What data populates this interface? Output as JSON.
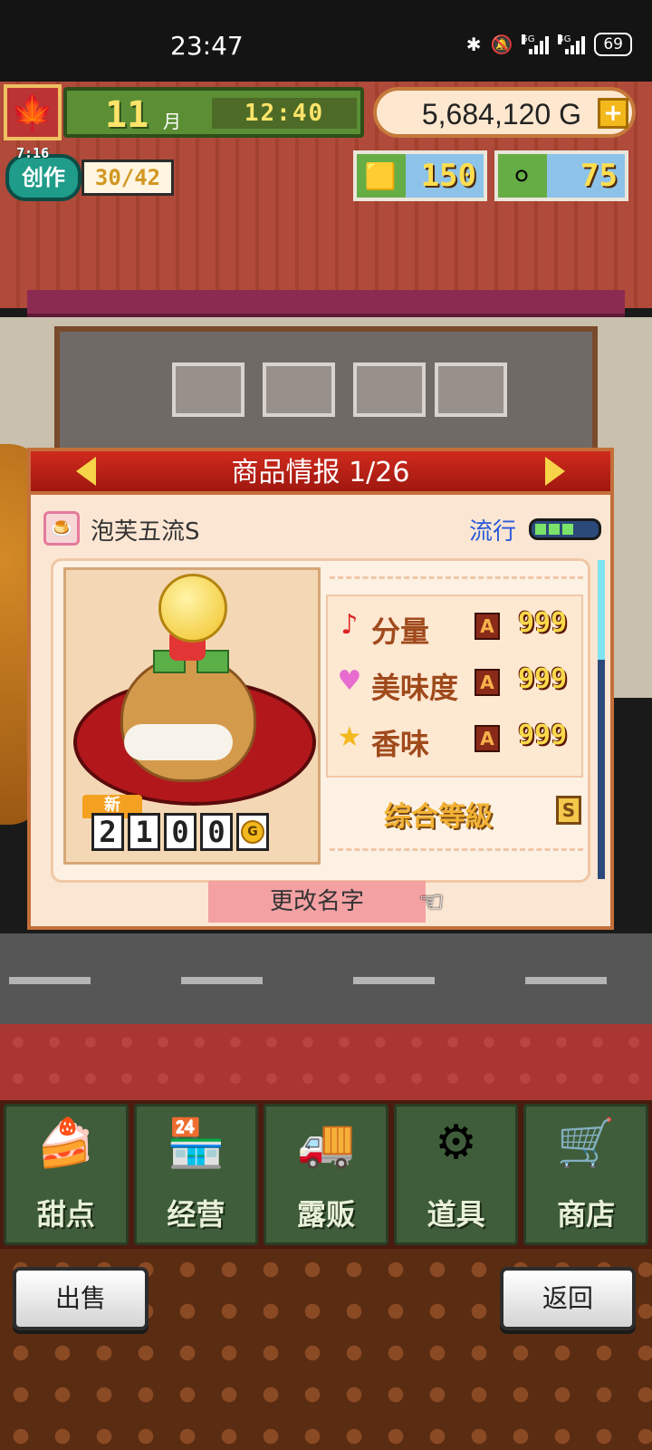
{
  "status_bar": {
    "time": "23:47",
    "network_5g": "5G",
    "network_4g": "4G",
    "battery": "69"
  },
  "hud": {
    "month_number": "11",
    "month_unit": "月",
    "clock": "12:40",
    "money": "5,684,120 G",
    "add_label": "+",
    "create": {
      "timer": "7:16",
      "label": "创作",
      "count": "30/42"
    },
    "gold_bars": "150",
    "silver_coins": "75"
  },
  "panel": {
    "title": "商品情报 1/26",
    "product_name": "泡芙五流S",
    "trend_label": "流行",
    "trend_level": 3,
    "trend_max": 5,
    "new_tag": "新",
    "price_digits": [
      "2",
      "1",
      "0",
      "0"
    ],
    "price_unit": "G",
    "stats": [
      {
        "label": "分量",
        "grade": "A",
        "value": "999",
        "icon": "music-note-icon"
      },
      {
        "label": "美味度",
        "grade": "A",
        "value": "999",
        "icon": "heart-icon"
      },
      {
        "label": "香味",
        "grade": "A",
        "value": "999",
        "icon": "star-icon"
      }
    ],
    "overall_label": "综合等級",
    "overall_grade": "S",
    "rename_label": "更改名字"
  },
  "nav": [
    {
      "label": "甜点",
      "icon": "cake-icon"
    },
    {
      "label": "经营",
      "icon": "shop-icon"
    },
    {
      "label": "露贩",
      "icon": "food-truck-icon"
    },
    {
      "label": "道具",
      "icon": "gear-bag-icon"
    },
    {
      "label": "商店",
      "icon": "cart-icon"
    }
  ],
  "footer": {
    "sell_label": "出售",
    "back_label": "返回"
  },
  "colors": {
    "panel_header": "#c0221a",
    "nav_bg": "#3f5d3a",
    "trend_blue": "#2a5ad8"
  }
}
